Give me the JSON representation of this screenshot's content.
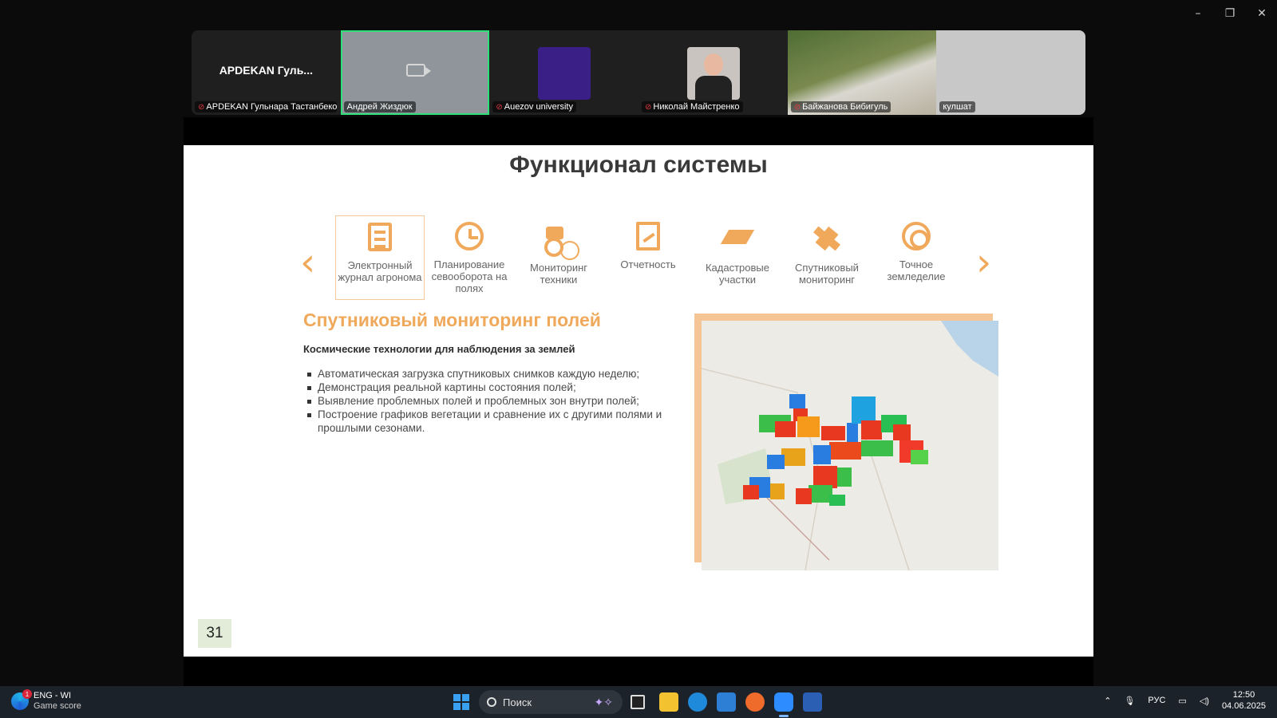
{
  "window": {
    "controls": [
      "–",
      "❐",
      "✕"
    ]
  },
  "participants": [
    {
      "display_name": "APDEKAN Гуль...",
      "label": "APDEKAN Гульнара Тастанбеко...",
      "muted": true
    },
    {
      "label": "Андрей Жиздюк",
      "muted": false,
      "video_off": true,
      "active_speaker": true
    },
    {
      "label": "Auezov university",
      "muted": true
    },
    {
      "label": "Николай Майстренко",
      "muted": true
    },
    {
      "label": "Байжанова Бибигуль",
      "muted": true
    },
    {
      "label": "кулшат",
      "muted": false
    }
  ],
  "slide": {
    "title": "Функционал системы",
    "features": [
      {
        "label": "Электронный журнал агронома",
        "icon": "journal-icon",
        "selected": true
      },
      {
        "label": "Планирование севооборота на полях",
        "icon": "clock-icon"
      },
      {
        "label": "Мониторинг техники",
        "icon": "tractor-icon"
      },
      {
        "label": "Отчетность",
        "icon": "report-icon"
      },
      {
        "label": "Кадастровые участки",
        "icon": "parcel-icon"
      },
      {
        "label": "Спутниковый мониторинг",
        "icon": "satellite-icon"
      },
      {
        "label": "Точное земледелие",
        "icon": "target-icon"
      }
    ],
    "section_heading": "Спутниковый мониторинг полей",
    "section_caption": "Космические технологии для наблюдения за землей",
    "bullets": [
      "Автоматическая загрузка спутниковых снимков каждую неделю;",
      "Демонстрация реальной картины состояния полей;",
      "Выявление проблемных полей и проблемных зон внутри полей;",
      "Построение графиков вегетации и сравнение их с другими полями и прошлыми сезонами."
    ],
    "page_number": "31",
    "accent_color": "#f0a95b"
  },
  "taskbar": {
    "notification_title": "ENG - WI",
    "notification_subtitle": "Game score",
    "notification_badge": "1",
    "search_placeholder": "Поиск",
    "language": "РУС",
    "time": "12:50",
    "date": "04.06.2025"
  }
}
